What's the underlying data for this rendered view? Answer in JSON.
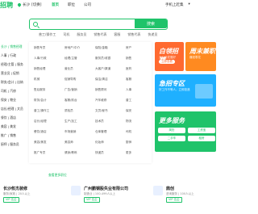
{
  "header": {
    "logo": "招聘",
    "city": "长沙",
    "city_switch": "[切换]",
    "nav": [
      "首页",
      "职位",
      "公司"
    ],
    "nav_active": 0,
    "actions": [
      "手机上赶集",
      "▾"
    ]
  },
  "search": {
    "placeholder": "",
    "button_label": "搜索",
    "hot": [
      "普工/操作工",
      "司机",
      "服务员",
      "销售代表",
      "客服",
      "销售代表",
      "快递员",
      "厨师/厨师长"
    ]
  },
  "categories": [
    "长沙 | 销售经理",
    "人事 | 行政",
    "经理/主管 | 服务",
    "营业员 | 促销",
    "财务/会计 | 出纳",
    "司机 | 汽修",
    "保安 | 物业",
    "店长/经理 | 文员",
    "餐饮 | 酒店",
    "美容 | 美发",
    "推广 | 销售",
    "厨师 | 服务员"
  ],
  "mega_rows": [
    [
      "销售专员",
      "房地产/中介",
      "保险/金融",
      "房产"
    ],
    [
      "人事/行政",
      "经理/主管",
      "服务员/收银",
      "销售"
    ],
    [
      "销售经理",
      "营业员",
      "大客户/渠道",
      "医药"
    ],
    [
      "机械",
      "促销导购",
      "保洁/清洁",
      "客服"
    ],
    [
      "售后服务",
      "广告/营销",
      "销售顾问",
      "人事"
    ],
    [
      "财务/会计",
      "客服/前台",
      "汽车维修",
      "普工"
    ],
    [
      "普工/操作工",
      "质检员",
      "文员/秘书",
      "保安"
    ],
    [
      "店长/经理",
      "生产/加工",
      "技术员",
      "物流"
    ],
    [
      "餐饮/酒店",
      "市场营销",
      "仓库管理",
      "司机"
    ],
    [
      "美容/美发",
      "美容师",
      "化妆师",
      "厨师"
    ],
    [
      "推广专员",
      "健身/教练",
      "快递员",
      "更多"
    ]
  ],
  "more_jobs": "查看更多职位",
  "banners": [
    {
      "title": "白领招聘",
      "sub": "大公司发展好",
      "tag": "立即查看"
    },
    {
      "title": "周末兼职",
      "sub": "赚钱零花",
      "tag": "查看"
    },
    {
      "title": "急招专区",
      "sub": "好工作不等人，立即投递",
      "tag": "马上应聘"
    },
    {
      "title": "更多服务",
      "chips": [
        "简历",
        "工资宝",
        "二手车",
        "租房"
      ]
    }
  ],
  "companies": [
    {
      "name": "长沙攸杰装修",
      "meta": "服务/家政 | 20人以上",
      "badge": "VIP 名企"
    },
    {
      "name": "广州鹏钢股失业有限公司",
      "meta": "制造业 | 100-499人以上",
      "badge": "VIP 名企"
    },
    {
      "name": "鼎创",
      "meta": "咨询服务 | 100人以上",
      "badge": "VIP 名企"
    }
  ],
  "colors": {
    "brand": "#1fc36a",
    "orange": "#ff6a30",
    "blue": "#1fb0ff"
  }
}
